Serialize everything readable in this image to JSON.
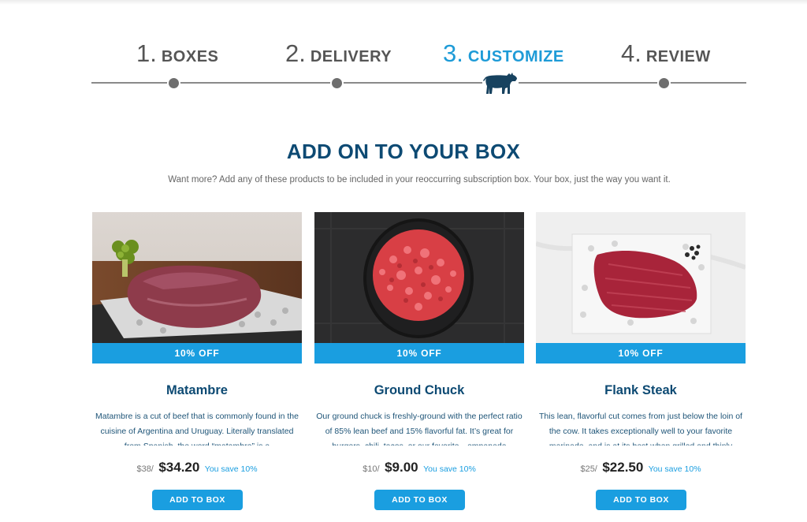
{
  "stepper": {
    "steps": [
      {
        "num": "1.",
        "label": "BOXES",
        "active": false
      },
      {
        "num": "2.",
        "label": "DELIVERY",
        "active": false
      },
      {
        "num": "3.",
        "label": "CUSTOMIZE",
        "active": true
      },
      {
        "num": "4.",
        "label": "REVIEW",
        "active": false
      }
    ],
    "current_icon": "cow-icon"
  },
  "section": {
    "title": "ADD ON TO YOUR BOX",
    "subtitle": "Want more? Add any of these products to be included in your reoccurring subscription box. Your box, just the way you want it."
  },
  "products": [
    {
      "badge": "10% OFF",
      "name": "Matambre",
      "description": "Matambre is a cut of beef that is commonly found in the cuisine of Argentina and Uruguay. Literally translated from Spanish, the word “matambre” is a",
      "old_price": "$38/",
      "price": "$34.20",
      "savings": "You save 10%",
      "button": "ADD TO BOX"
    },
    {
      "badge": "10% OFF",
      "name": "Ground Chuck",
      "description": "Our ground chuck is freshly-ground with the perfect ratio of 85% lean beef and 15% flavorful fat. It’s great for burgers, chili, tacos, or our favorite—empanada",
      "old_price": "$10/",
      "price": "$9.00",
      "savings": "You save 10%",
      "button": "ADD TO BOX"
    },
    {
      "badge": "10% OFF",
      "name": "Flank Steak",
      "description": "This lean, flavorful cut comes from just below the loin of the cow. It takes exceptionally well to your favorite marinade, and is at its best when grilled and thinly",
      "old_price": "$25/",
      "price": "$22.50",
      "savings": "You save 10%",
      "button": "ADD TO BOX"
    }
  ],
  "colors": {
    "accent": "#1a9ee0",
    "heading": "#0d4a73",
    "step_inactive": "#555555"
  }
}
